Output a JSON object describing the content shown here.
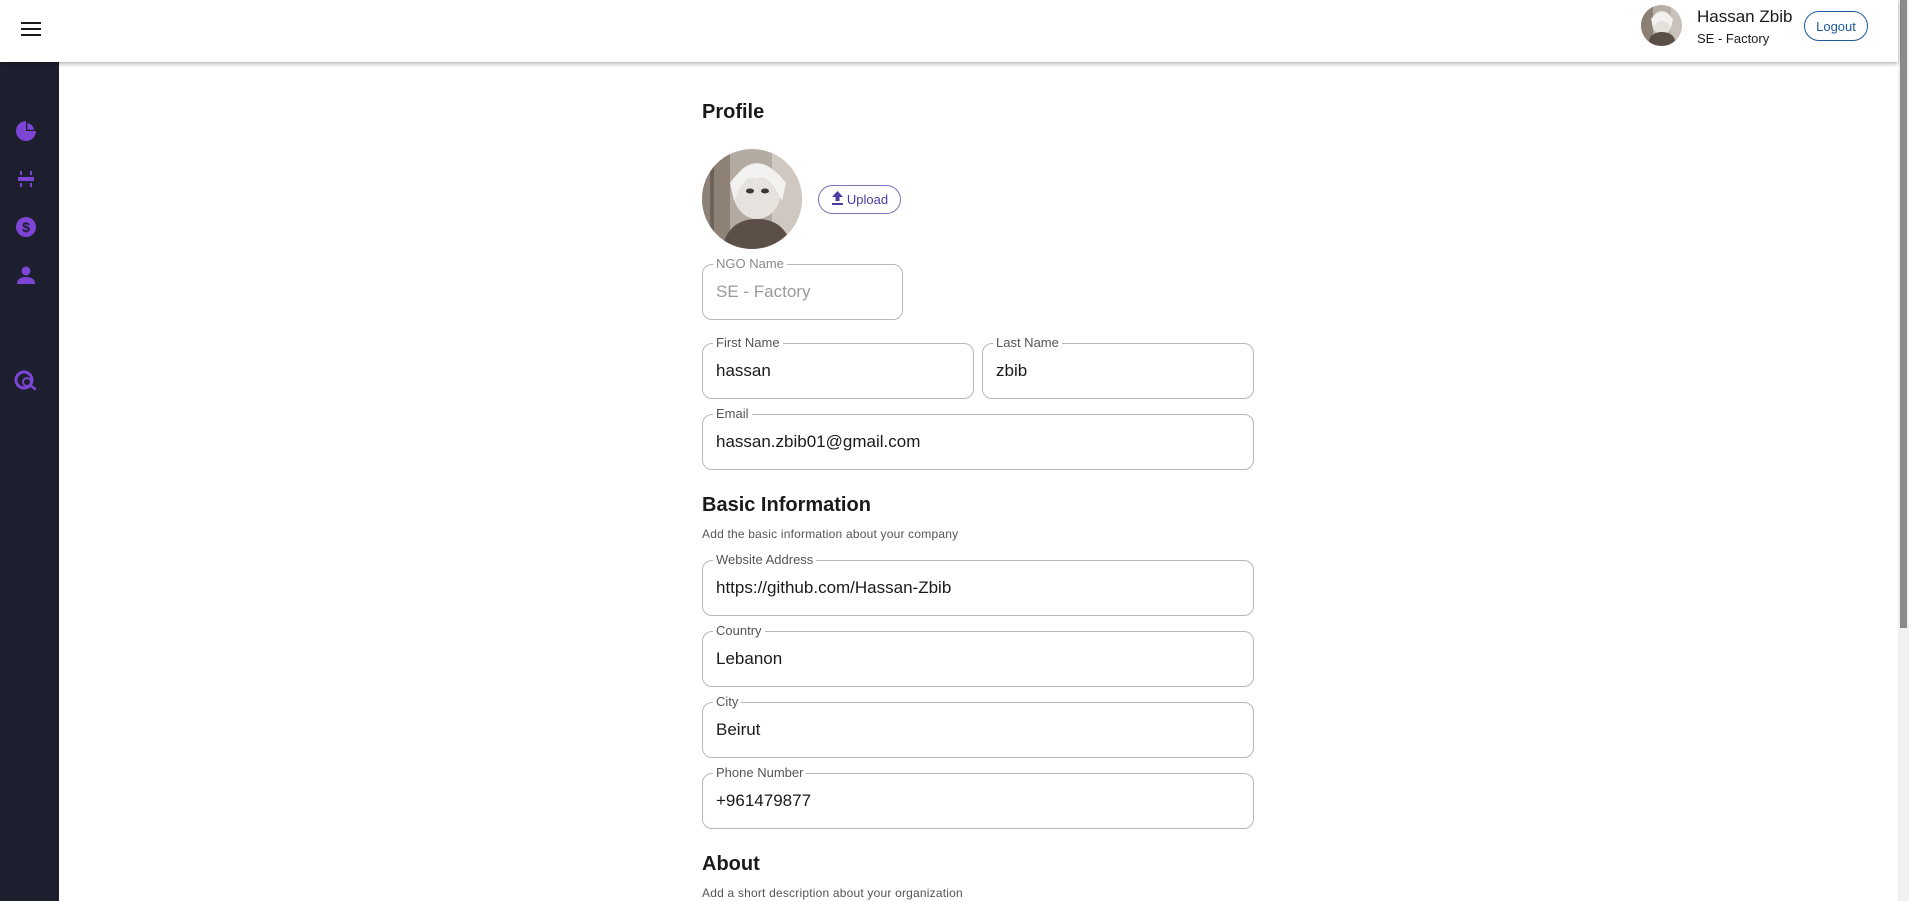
{
  "header": {
    "user_name": "Hassan Zbib",
    "user_org": "SE - Factory",
    "logout_label": "Logout"
  },
  "sidebar": {
    "items": [
      {
        "icon": "pie-chart-icon"
      },
      {
        "icon": "event-icon"
      },
      {
        "icon": "dollar-icon"
      },
      {
        "icon": "person-icon"
      },
      {
        "icon": "search-magnify-icon"
      }
    ]
  },
  "profile": {
    "title": "Profile",
    "upload_label": "Upload",
    "ngo_name": {
      "label": "NGO Name",
      "value": "SE - Factory"
    },
    "first_name": {
      "label": "First Name",
      "value": "hassan"
    },
    "last_name": {
      "label": "Last Name",
      "value": "zbib"
    },
    "email": {
      "label": "Email",
      "value": "hassan.zbib01@gmail.com"
    }
  },
  "basic_info": {
    "title": "Basic Information",
    "subtitle": "Add the basic information about your company",
    "website": {
      "label": "Website Address",
      "value": "https://github.com/Hassan-Zbib"
    },
    "country": {
      "label": "Country",
      "value": "Lebanon"
    },
    "city": {
      "label": "City",
      "value": "Beirut"
    },
    "phone": {
      "label": "Phone Number",
      "value": "+961479877"
    }
  },
  "about": {
    "title": "About",
    "subtitle": "Add a short description about your organization"
  },
  "colors": {
    "accent": "#7d45d6",
    "sidebar_bg": "#1d1f2e",
    "logout_border": "#1e5aa0"
  }
}
